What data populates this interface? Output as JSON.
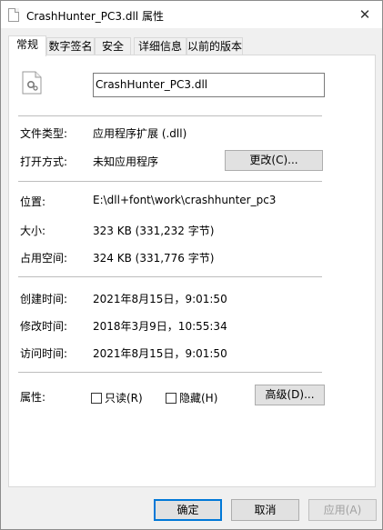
{
  "window": {
    "title": "CrashHunter_PC3.dll 属性",
    "close": "✕"
  },
  "tabs": [
    {
      "label": "常规"
    },
    {
      "label": "数字签名"
    },
    {
      "label": "安全"
    },
    {
      "label": "详细信息"
    },
    {
      "label": "以前的版本"
    }
  ],
  "general": {
    "file_name": "CrashHunter_PC3.dll",
    "file_type_label": "文件类型:",
    "file_type_value": "应用程序扩展 (.dll)",
    "open_with_label": "打开方式:",
    "open_with_value": "未知应用程序",
    "change_button": "更改(C)...",
    "location_label": "位置:",
    "location_value": "E:\\dll+font\\work\\crashhunter_pc3",
    "size_label": "大小:",
    "size_value": "323 KB (331,232 字节)",
    "disk_size_label": "占用空间:",
    "disk_size_value": "324 KB (331,776 字节)",
    "created_label": "创建时间:",
    "created_value": "2021年8月15日，9:01:50",
    "modified_label": "修改时间:",
    "modified_value": "2018年3月9日，10:55:34",
    "accessed_label": "访问时间:",
    "accessed_value": "2021年8月15日，9:01:50",
    "attributes_label": "属性:",
    "readonly_label": "只读(R)",
    "hidden_label": "隐藏(H)",
    "advanced_button": "高级(D)..."
  },
  "footer": {
    "ok": "确定",
    "cancel": "取消",
    "apply": "应用(A)"
  }
}
